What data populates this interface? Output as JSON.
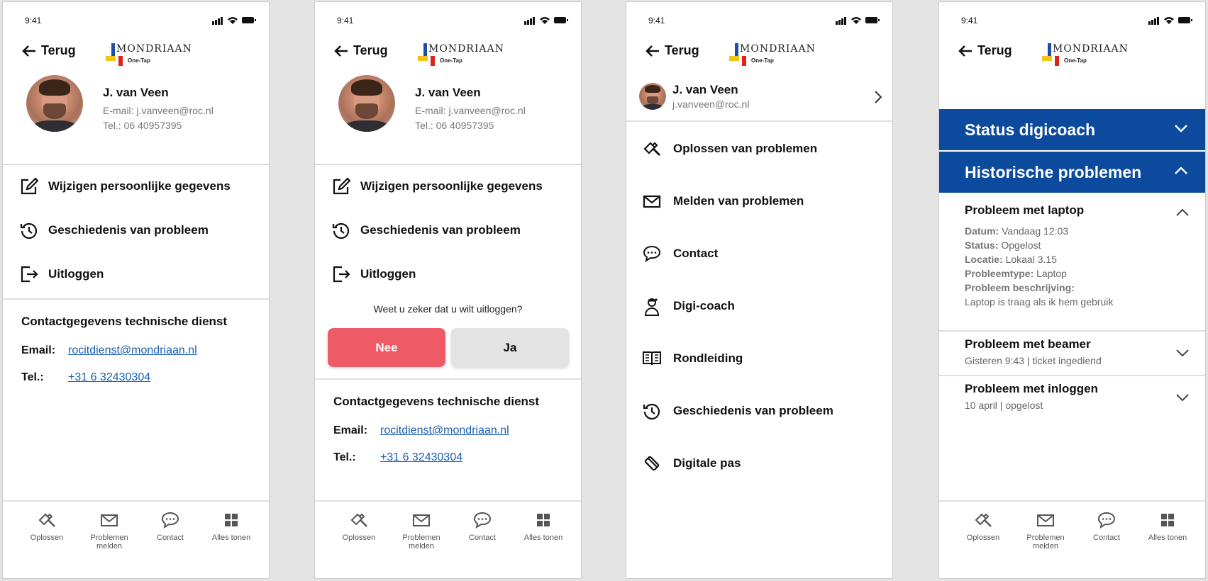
{
  "status_bar": {
    "time": "9:41"
  },
  "header": {
    "back_label": "Terug",
    "logo_text": "MONDRIAAN",
    "logo_tagline": "One-Tap"
  },
  "profile": {
    "name": "J. van Veen",
    "email_line": "E-mail: j.vanveen@roc.nl",
    "phone_line": "Tel.: 06 40957395",
    "email_short": "j.vanveen@roc.nl"
  },
  "profile_menu": {
    "edit": "Wijzigen persoonlijke gegevens",
    "history": "Geschiedenis van probleem",
    "logout": "Uitloggen"
  },
  "logout_confirm": {
    "question": "Weet u zeker dat u wilt uitloggen?",
    "no": "Nee",
    "yes": "Ja"
  },
  "contact": {
    "title": "Contactgegevens technische dienst",
    "email_label": "Email:",
    "email_value": "rocitdienst@mondriaan.nl",
    "tel_label": "Tel.:",
    "tel_value": "+31 6 32430304"
  },
  "tabbar": [
    {
      "icon": "hammer-icon",
      "label": "Oplossen"
    },
    {
      "icon": "envelope-icon",
      "label": "Problemen melden"
    },
    {
      "icon": "chat-icon",
      "label": "Contact"
    },
    {
      "icon": "grid-icon",
      "label": "Alles tonen"
    }
  ],
  "nav_menu": [
    {
      "icon": "hammer-icon",
      "label": "Oplossen van problemen"
    },
    {
      "icon": "envelope-icon",
      "label": "Melden van problemen"
    },
    {
      "icon": "chat-icon",
      "label": "Contact"
    },
    {
      "icon": "person-icon",
      "label": "Digi-coach"
    },
    {
      "icon": "book-icon",
      "label": "Rondleiding"
    },
    {
      "icon": "history-icon",
      "label": "Geschiedenis van probleem"
    },
    {
      "icon": "card-icon",
      "label": "Digitale pas"
    }
  ],
  "history_screen": {
    "status_header": "Status digicoach",
    "history_header": "Historische problemen",
    "problems": [
      {
        "title": "Probleem met laptop",
        "expanded": true,
        "details": [
          {
            "label": "Datum:",
            "value": "Vandaag 12:03"
          },
          {
            "label": "Status:",
            "value": "Opgelost"
          },
          {
            "label": "Locatie:",
            "value": "Lokaal 3.15"
          },
          {
            "label": "Probleemtype:",
            "value": "Laptop"
          },
          {
            "label": "Probleem beschrijving:",
            "value": ""
          }
        ],
        "description": "Laptop is traag als ik hem gebruik"
      },
      {
        "title": "Probleem met beamer",
        "expanded": false,
        "summary": "Gisteren  9:43 | ticket ingediend"
      },
      {
        "title": "Probleem met inloggen",
        "expanded": false,
        "summary": "10 april | opgelost"
      }
    ]
  },
  "colors": {
    "accent_blue": "#0b4a9c",
    "danger": "#ee5b67",
    "link": "#1a5fb4"
  }
}
